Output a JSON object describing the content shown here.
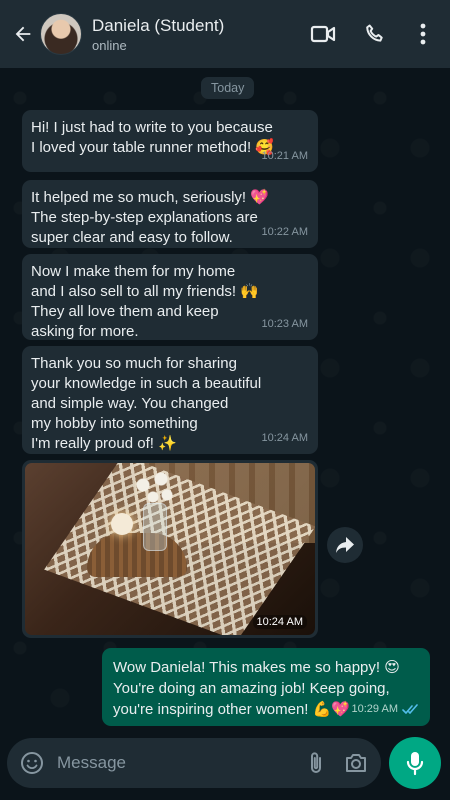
{
  "header": {
    "name": "Daniela (Student)",
    "status": "online"
  },
  "chat": {
    "date_chip": "Today",
    "messages": [
      {
        "lines": [
          "Hi! I just had to write to you because",
          "I loved your table runner method! 🥰"
        ],
        "time": "10:21 AM"
      },
      {
        "lines": [
          "It helped me so much, seriously! 💖",
          "The step-by-step explanations are",
          "super clear and easy to follow."
        ],
        "time": "10:22 AM"
      },
      {
        "lines": [
          "Now I make them for my home",
          "and I also sell to all my friends! 🙌",
          "They all love them and keep",
          "asking for more."
        ],
        "time": "10:23 AM"
      },
      {
        "lines": [
          "Thank you so much for sharing",
          "your knowledge in such a beautiful",
          "and simple way. You changed",
          "my hobby into something",
          "I'm really proud of! ✨"
        ],
        "time": "10:24 AM"
      }
    ],
    "photo_time": "10:24 AM",
    "outgoing": {
      "lines": [
        "Wow Daniela! This makes me so happy! 😍",
        "You're doing an amazing job! Keep going,",
        "you're inspiring other women! 💪💖"
      ],
      "time": "10:29 AM"
    }
  },
  "composer": {
    "placeholder": "Message"
  },
  "colors": {
    "background": "#0b141a",
    "incoming_bubble": "#1f2c34",
    "outgoing_bubble": "#005c4b",
    "accent": "#00a884",
    "read_ticks": "#53bdeb"
  },
  "icons": {
    "back": "arrow-left-icon",
    "video": "video-camera-icon",
    "call": "phone-icon",
    "menu": "more-vertical-icon",
    "emoji": "smiley-icon",
    "attach": "paperclip-icon",
    "camera": "camera-icon",
    "mic": "microphone-icon",
    "forward": "forward-arrow-icon"
  }
}
